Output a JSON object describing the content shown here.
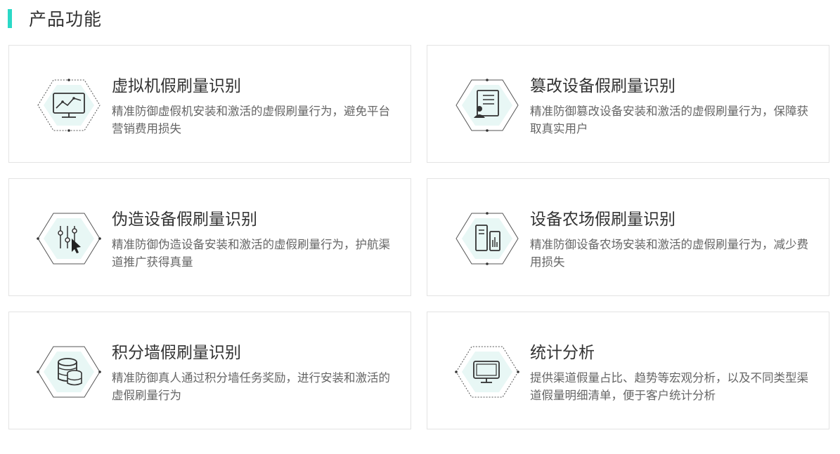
{
  "section": {
    "title": "产品功能",
    "accent_color": "#2bd9c7"
  },
  "cards": [
    {
      "title": "虚拟机假刷量识别",
      "desc": "精准防御虚假机安装和激活的虚假刷量行为，避免平台营销费用损失",
      "icon": "monitor-chart-icon"
    },
    {
      "title": "篡改设备假刷量识别",
      "desc": "精准防御篡改设备安装和激活的虚假刷量行为，保障获取真实用户",
      "icon": "user-id-card-icon"
    },
    {
      "title": "伪造设备假刷量识别",
      "desc": "精准防御伪造设备安装和激活的虚假刷量行为，护航渠道推广获得真量",
      "icon": "sliders-cursor-icon"
    },
    {
      "title": "设备农场假刷量识别",
      "desc": "精准防御设备农场安装和激活的虚假刷量行为，减少费用损失",
      "icon": "server-devices-icon"
    },
    {
      "title": "积分墙假刷量识别",
      "desc": "精准防御真人通过积分墙任务奖励，进行安装和激活的虚假刷量行为",
      "icon": "database-icon"
    },
    {
      "title": "统计分析",
      "desc": "提供渠道假量占比、趋势等宏观分析，以及不同类型渠道假量明细清单，便于客户统计分析",
      "icon": "monitor-icon"
    }
  ]
}
